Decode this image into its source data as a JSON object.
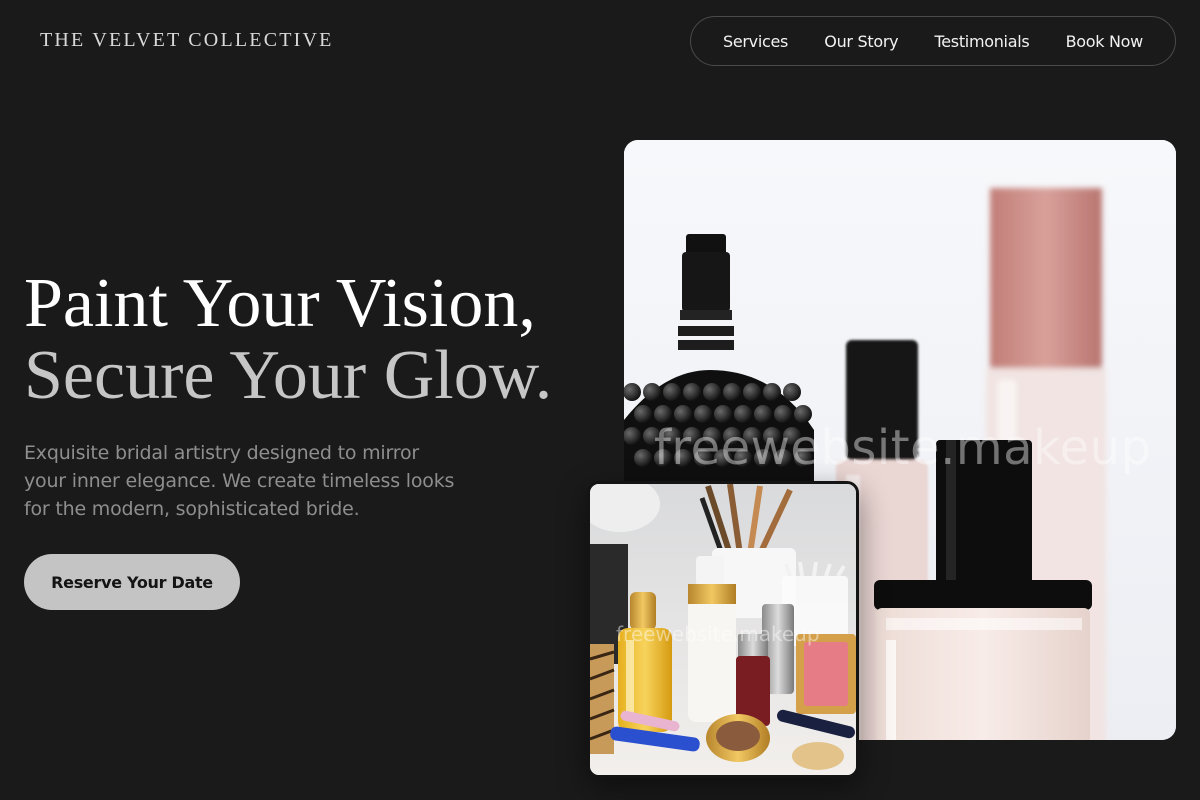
{
  "header": {
    "brand": "THE VELVET COLLECTIVE",
    "nav": [
      {
        "label": "Services"
      },
      {
        "label": "Our Story"
      },
      {
        "label": "Testimonials"
      },
      {
        "label": "Book Now"
      }
    ]
  },
  "hero": {
    "title_line1": "Paint Your Vision,",
    "title_line2": "Secure Your Glow.",
    "description": "Exquisite bridal artistry designed to mirror your inner elegance. We create timeless looks for the modern, sophisticated bride.",
    "cta_label": "Reserve Your Date"
  },
  "images": {
    "main_watermark": "freewebsite.makeup",
    "overlay_watermark": "freewebsite.makeup"
  },
  "colors": {
    "background": "#1a1a1b",
    "cta_background": "#c4c4c4",
    "muted_text": "#8e8e8e"
  }
}
